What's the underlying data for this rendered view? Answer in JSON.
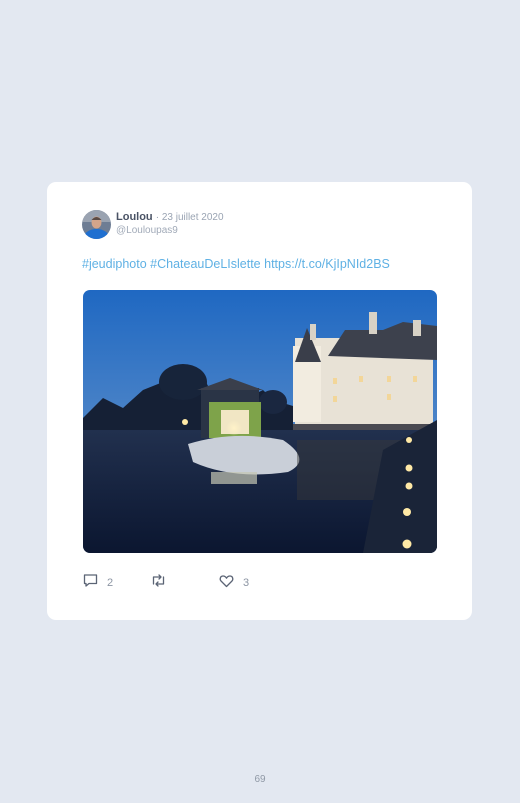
{
  "tweet": {
    "author_name": "Loulou",
    "date": "· 23 juillet 2020",
    "handle": "@Louloupas9",
    "hashtag1": "#jeudiphoto",
    "hashtag2": "#ChateauDeLIslette",
    "link": "https://t.co/KjIpNId2BS",
    "photo_description": "Château de l'Islette illuminé au crépuscule, reflet dans l'eau",
    "reply_count": "2",
    "retweet_count": "",
    "like_count": "3"
  },
  "page": {
    "number": "69"
  },
  "colors": {
    "background": "#e3e8f1",
    "card": "#ffffff",
    "link": "#5fb1e4",
    "icon": "#5b6475"
  },
  "icons": {
    "reply": "comment-icon",
    "retweet": "retweet-icon",
    "like": "heart-icon"
  }
}
